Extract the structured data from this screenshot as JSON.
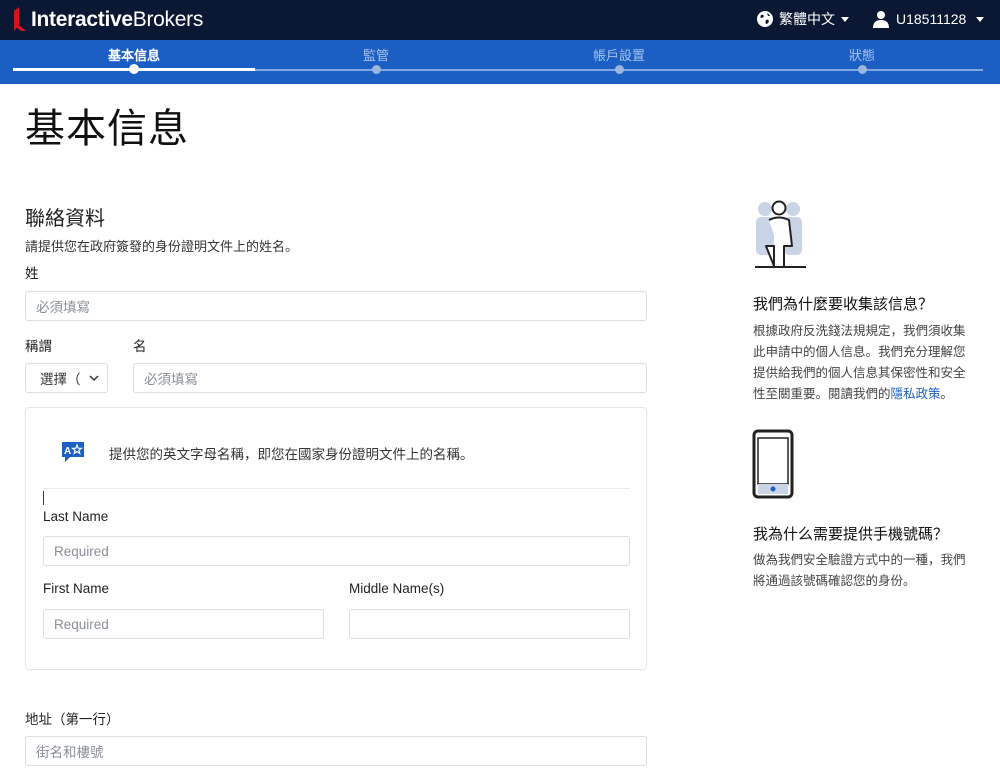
{
  "header": {
    "brand_bold": "Interactive",
    "brand_light": "Brokers",
    "language": "繁體中文",
    "account": "U18511128"
  },
  "stepper": {
    "steps": [
      {
        "label": "基本信息",
        "active": true
      },
      {
        "label": "監管",
        "active": false
      },
      {
        "label": "帳戶設置",
        "active": false
      },
      {
        "label": "狀態",
        "active": false
      }
    ]
  },
  "page": {
    "title": "基本信息"
  },
  "contact": {
    "title": "聯絡資料",
    "description": "請提供您在政府簽發的身份證明文件上的姓名。",
    "surname_label": "姓",
    "surname_placeholder": "必須填寫",
    "salutation_label": "稱謂",
    "salutation_value": "選擇（",
    "given_name_label": "名",
    "given_name_placeholder": "必須填寫"
  },
  "latin_panel": {
    "note": "提供您的英文字母名稱，即您在國家身份證明文件上的名稱。",
    "last_name_label": "Last Name",
    "last_name_placeholder": "Required",
    "first_name_label": "First Name",
    "first_name_placeholder": "Required",
    "middle_name_label": "Middle Name(s)",
    "middle_name_placeholder": ""
  },
  "address": {
    "label": "地址（第一行）",
    "placeholder": "街名和樓號"
  },
  "sidebar": {
    "why_title": "我們為什麼要收集該信息？",
    "why_text": "根據政府反洗錢法規規定，我們須收集此申請中的個人信息。我們充分理解您提供給我們的個人信息其保密性和安全性至關重要。閱讀我們的",
    "privacy_link": "隱私政策",
    "why_text_end": "。",
    "phone_title": "我為什么需要提供手機號碼？",
    "phone_text": "做為我們安全驗證方式中的一種，我們將通過該號碼確認您的身份。"
  },
  "colors": {
    "topbar": "#0b1833",
    "stepper": "#1b5fc4",
    "link": "#1b5fc4",
    "brand_red": "#d81222"
  },
  "icons": {
    "language": "globe-icon",
    "account": "user-icon",
    "translate": "translate-icon",
    "people": "people-illustration",
    "phone": "mobile-phone-illustration"
  }
}
